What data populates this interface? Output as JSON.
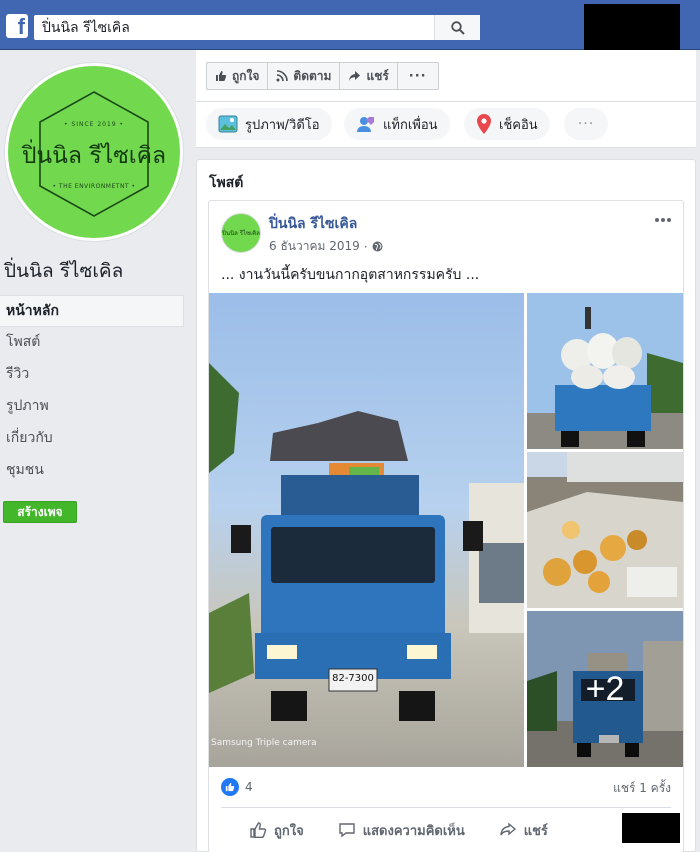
{
  "header": {
    "search_value": "ปิ่นนิล รีไซเคิล",
    "logo_letter": "f"
  },
  "page": {
    "name": "ปิ่นนิล รีไซเคิล",
    "logo_top_text": "• SINCE 2019 •",
    "logo_name": "ปิ่นนิล รีไซเคิล",
    "logo_bottom_text": "• THE ENVIRONMETNT •"
  },
  "sidebar": {
    "items": [
      {
        "label": "หน้าหลัก"
      },
      {
        "label": "โพสต์"
      },
      {
        "label": "รีวิว"
      },
      {
        "label": "รูปภาพ"
      },
      {
        "label": "เกี่ยวกับ"
      },
      {
        "label": "ชุมชน"
      }
    ],
    "create_page_label": "สร้างเพจ"
  },
  "actions": {
    "like": "ถูกใจ",
    "follow": "ติดตาม",
    "share": "แชร์",
    "more": "···"
  },
  "composer": {
    "photo_video": "รูปภาพ/วิดีโอ",
    "tag_friends": "แท็กเพื่อน",
    "check_in": "เช็คอิน",
    "more": "···"
  },
  "posts_section": {
    "title": "โพสต์"
  },
  "post": {
    "author": "ปิ่นนิล รีไซเคิล",
    "date": "6 ธันวาคม 2019",
    "separator": "·",
    "text": "... งานวันนี้ครับขนกากอุตสาหกรรมครับ ...",
    "avatar_text": "ปิ่นนิล รีไซเคิล",
    "photo_more": "+2",
    "reaction_count": "4",
    "share_count": "แชร์ 1 ครั้ง",
    "photo_caption": "Samsung Triple camera",
    "plate": "82-7300",
    "action_like": "ถูกใจ",
    "action_comment": "แสดงความคิดเห็น",
    "action_share": "แชร์"
  },
  "colors": {
    "brand_blue": "#4267b2",
    "link_blue": "#385898",
    "create_green": "#42b72a",
    "avatar_green": "#72d84e",
    "like_blue": "#2078f4"
  }
}
